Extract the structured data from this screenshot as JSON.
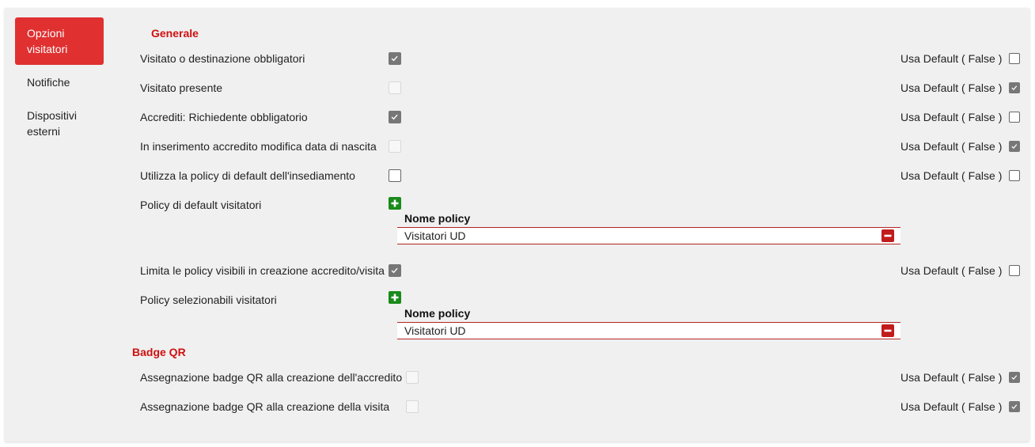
{
  "sidebar": {
    "items": [
      {
        "label": "Opzioni visitatori",
        "active": true
      },
      {
        "label": "Notifiche",
        "active": false
      },
      {
        "label": "Dispositivi esterni",
        "active": false
      }
    ]
  },
  "sections": {
    "generale": "Generale",
    "badge_qr": "Badge QR"
  },
  "rows": [
    {
      "label": "Visitato o destinazione obbligatori",
      "value": "checked",
      "default_label": "Usa Default ( False )",
      "default_checked": false
    },
    {
      "label": "Visitato presente",
      "value": "disabled",
      "default_label": "Usa Default ( False )",
      "default_checked": true
    },
    {
      "label": "Accrediti: Richiedente obbligatorio",
      "value": "checked",
      "default_label": "Usa Default ( False )",
      "default_checked": false
    },
    {
      "label": "In inserimento accredito modifica data di nascita",
      "value": "disabled",
      "default_label": "Usa Default ( False )",
      "default_checked": true
    },
    {
      "label": "Utilizza la policy di default dell'insediamento",
      "value": "unchecked",
      "default_label": "Usa Default ( False )",
      "default_checked": false
    },
    {
      "label": "Policy di default visitatori"
    },
    {
      "label": "Limita le policy visibili in creazione accredito/visita",
      "value": "checked",
      "default_label": "Usa Default ( False )",
      "default_checked": false
    },
    {
      "label": "Policy selezionabili visitatori"
    },
    {
      "label": "Assegnazione badge QR alla creazione dell'accredito",
      "value": "disabled",
      "default_label": "Usa Default ( False )",
      "default_checked": true
    },
    {
      "label": "Assegnazione badge QR alla creazione della visita",
      "value": "disabled",
      "default_label": "Usa Default ( False )",
      "default_checked": true
    }
  ],
  "policy_tables": [
    {
      "header": "Nome policy",
      "rows": [
        "Visitatori UD"
      ]
    },
    {
      "header": "Nome policy",
      "rows": [
        "Visitatori UD"
      ]
    }
  ],
  "colors": {
    "accent": "#e03030",
    "section_title": "#d01010",
    "add_button": "#1a8a1a",
    "remove_button": "#c01c1c",
    "checked": "#777777"
  },
  "icons": {
    "add": "plus-icon",
    "remove": "minus-icon",
    "check": "checkmark-icon"
  }
}
